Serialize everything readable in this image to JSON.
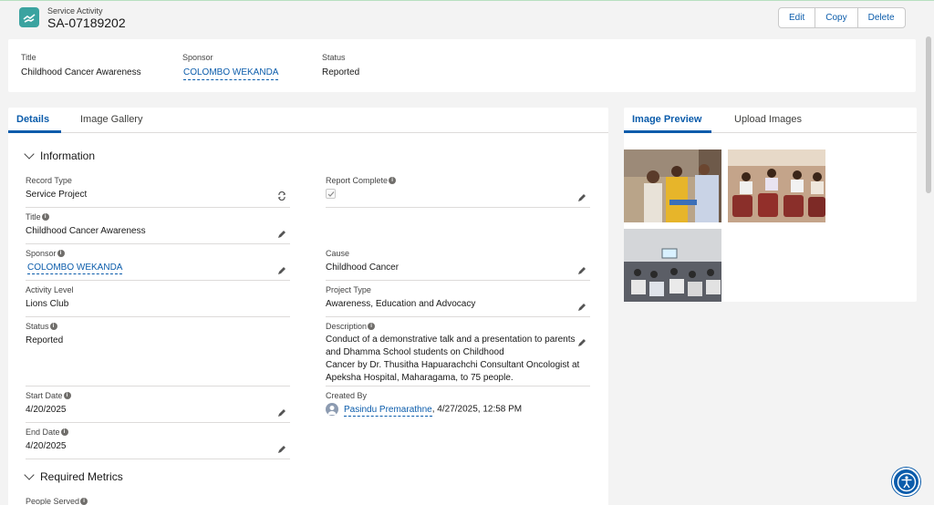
{
  "header": {
    "object_label": "Service Activity",
    "record_name": "SA-07189202",
    "buttons": {
      "edit": "Edit",
      "copy": "Copy",
      "delete": "Delete"
    }
  },
  "highlights": [
    {
      "label": "Title",
      "value": "Childhood Cancer Awareness"
    },
    {
      "label": "Sponsor",
      "value": "COLOMBO WEKANDA"
    },
    {
      "label": "Status",
      "value": "Reported"
    }
  ],
  "tabs": {
    "details": "Details",
    "gallery": "Image Gallery"
  },
  "sections": {
    "information": "Information",
    "required_metrics": "Required Metrics"
  },
  "fields": {
    "record_type": {
      "label": "Record Type",
      "value": "Service Project"
    },
    "report_complete": {
      "label": "Report Complete",
      "value": "checked"
    },
    "title": {
      "label": "Title",
      "value": "Childhood Cancer Awareness"
    },
    "sponsor": {
      "label": "Sponsor",
      "value": "COLOMBO WEKANDA"
    },
    "cause": {
      "label": "Cause",
      "value": "Childhood Cancer"
    },
    "activity_level": {
      "label": "Activity Level",
      "value": "Lions Club"
    },
    "project_type": {
      "label": "Project Type",
      "value": "Awareness, Education and Advocacy"
    },
    "status": {
      "label": "Status",
      "value": "Reported"
    },
    "description": {
      "label": "Description",
      "lines": [
        "Conduct of a demonstrative talk and a presentation to parents",
        "and Dhamma School students on Childhood",
        "Cancer by Dr. Thusitha Hapuarachchi Consultant Oncologist at",
        "Apeksha Hospital, Maharagama, to 75 people."
      ]
    },
    "start_date": {
      "label": "Start Date",
      "value": "4/20/2025"
    },
    "end_date": {
      "label": "End Date",
      "value": "4/20/2025"
    },
    "created_by": {
      "label": "Created By",
      "user": "Pasindu Premarathne",
      "timestamp": ", 4/27/2025, 12:58 PM"
    },
    "people_served": {
      "label": "People Served"
    }
  },
  "side_panel": {
    "tabs": {
      "preview": "Image Preview",
      "upload": "Upload Images"
    }
  },
  "colors": {
    "brand": "#0b5cab",
    "object_icon": "#3ba3a0",
    "border": "#dddbda"
  }
}
